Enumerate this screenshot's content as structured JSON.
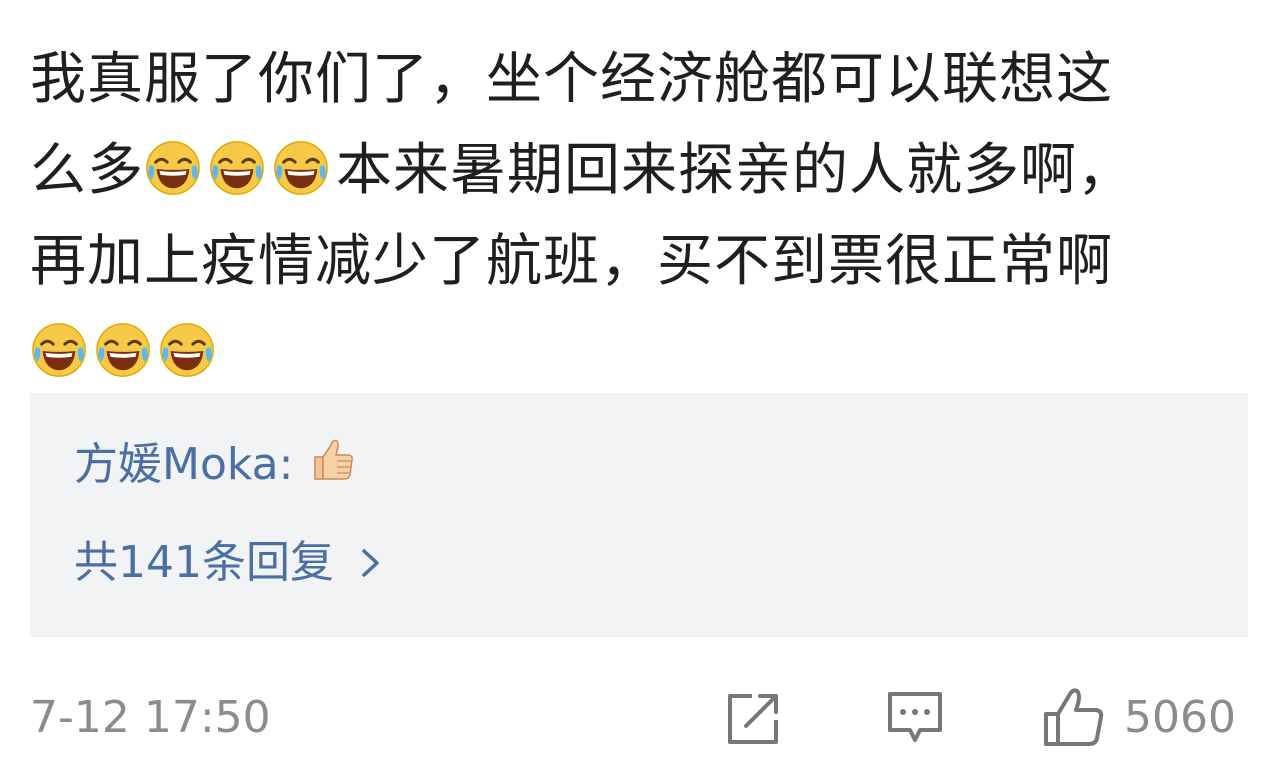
{
  "comment": {
    "line1": "我真服了你们了，坐个经济舱都可以联想这",
    "line2_pre": "么多",
    "line2_post": "本来暑期回来探亲的人就多啊，",
    "line3": "再加上疫情减少了航班，买不到票很正常啊",
    "emoji_name": "laughing-tears-emoji"
  },
  "reply_preview": {
    "author": "方媛Moka",
    "separator": ":",
    "emoji_name": "thumbs-up-emoji",
    "count_label": "共141条回复",
    "chevron": "chevron-right-icon"
  },
  "footer": {
    "timestamp": "7-12 17:50",
    "share_icon": "share-icon",
    "reply_icon": "comment-icon",
    "like_icon": "thumbs-up-icon",
    "like_count": "5060"
  },
  "colors": {
    "text": "#1f1f1f",
    "link": "#4a6fa3",
    "muted": "#8c8c8c",
    "reply_bg": "#f2f3f5"
  }
}
